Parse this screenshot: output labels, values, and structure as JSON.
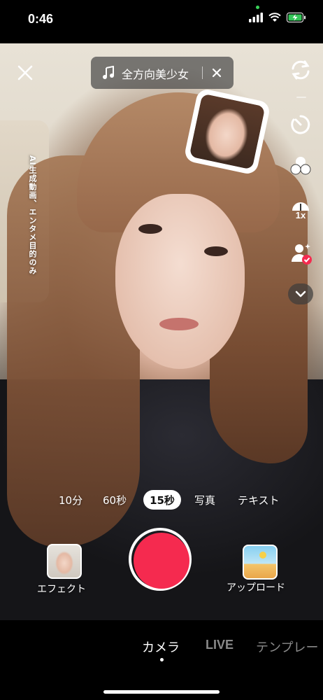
{
  "status_bar": {
    "time": "0:46"
  },
  "camera": {
    "music": {
      "title": "全方向美少女"
    },
    "vertical_note": "AI生成動画、エンタメ目的のみ",
    "side_icons": [
      "flip-camera-icon",
      "timer-icon",
      "filters-icon",
      "speed-1x-icon",
      "ai-person-icon",
      "chevron-down-icon"
    ],
    "speed_label": "1x"
  },
  "modes": {
    "items": [
      "10分",
      "60秒",
      "15秒",
      "写真",
      "テキスト"
    ],
    "selected": "15秒"
  },
  "actions": {
    "effect_label": "エフェクト",
    "upload_label": "アップロード"
  },
  "bottom_nav": {
    "tabs": [
      "カメラ",
      "LIVE",
      "テンプレー"
    ],
    "active": "カメラ"
  },
  "colors": {
    "record": "#f52a4f",
    "background": "#000000"
  }
}
